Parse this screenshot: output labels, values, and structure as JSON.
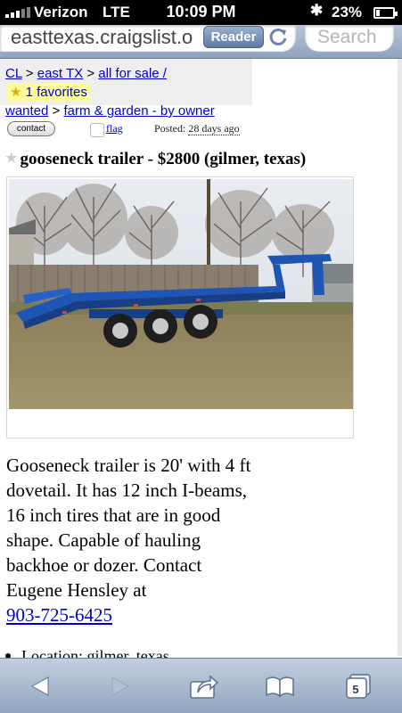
{
  "status_bar": {
    "carrier": "Verizon",
    "network": "LTE",
    "time": "10:09 PM",
    "battery_percent": "23%",
    "battery_level": 0.23
  },
  "browser": {
    "url": "easttexas.craigslist.o",
    "reader_label": "Reader",
    "search_placeholder": "Search",
    "tab_count": "5"
  },
  "breadcrumb": {
    "cl": "CL",
    "region": "east TX",
    "category": "all for sale /",
    "favorites": "1 favorites",
    "wanted": "wanted",
    "subcategory": "farm & garden - by owner",
    "separator": ">"
  },
  "post": {
    "contact_label": "contact",
    "flag_label": "flag",
    "posted_label": "Posted:",
    "posted_ago": "28 days ago",
    "title": "gooseneck trailer - $2800 (gilmer, texas)",
    "description": "Gooseneck trailer is 20' with 4 ft dovetail. It has 12 inch I-beams, 16 inch tires that are in good shape. Capable of hauling backhoe or dozer. Contact Eugene Hensley at",
    "phone": "903-725-6425",
    "location": "Location: gilmer, texas"
  },
  "icons": {
    "back": "back-arrow-icon",
    "forward": "forward-arrow-icon",
    "share": "share-icon",
    "bookmarks": "bookmarks-icon",
    "tabs": "tabs-icon",
    "reload": "reload-icon",
    "favorite_star": "star-icon",
    "bluetooth": "bluetooth-icon"
  },
  "colors": {
    "link": "#0000cc",
    "trailer_blue": "#1f55b5",
    "toolbar": "#a9b8cd"
  }
}
